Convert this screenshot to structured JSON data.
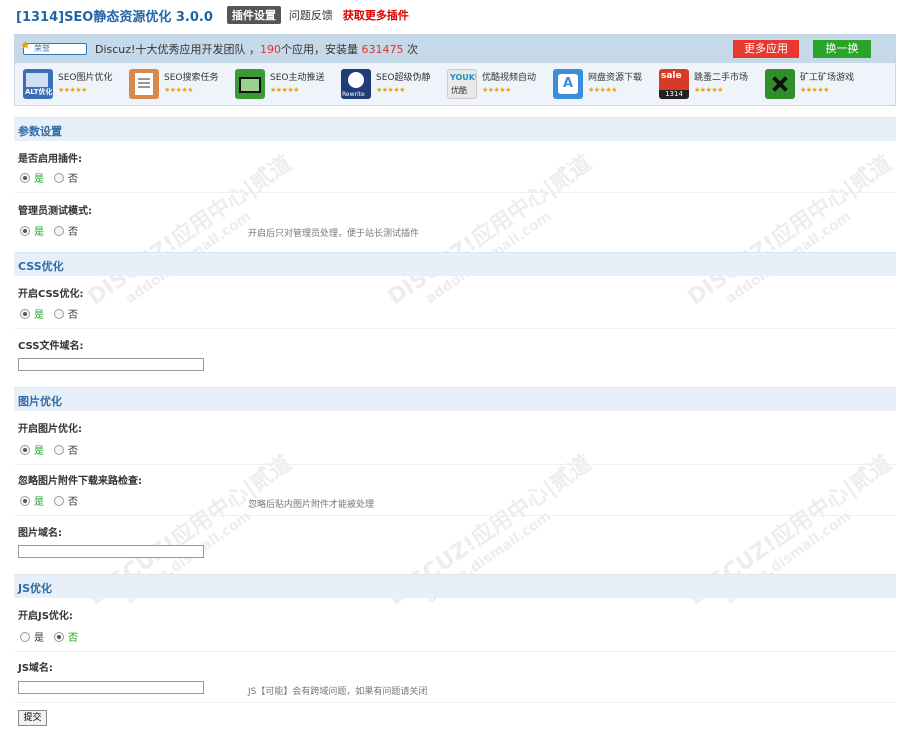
{
  "header": {
    "plugin_title": "[1314]SEO静态资源优化 3.0.0",
    "tab_settings": "插件设置",
    "tab_feedback": "问题反馈",
    "tab_more_plugins": "获取更多插件"
  },
  "banner": {
    "badge": "荣誉",
    "text_prefix": "Discuz!十大优秀应用开发团队 ，",
    "app_count": "190",
    "text_mid": "个应用，安装量 ",
    "install_count": "631475",
    "text_suffix": " 次",
    "more_apps": "更多应用",
    "swap": "换一换",
    "stars": "★★★★★",
    "apps": [
      {
        "name": "SEO图片优化",
        "icon": "image-seo-icon",
        "color": "#3a6fb7"
      },
      {
        "name": "SEO搜索任务",
        "icon": "clipboard-icon",
        "color": "#d8894b"
      },
      {
        "name": "SEO主动推送",
        "icon": "push-icon",
        "color": "#3a9b36"
      },
      {
        "name": "SEO超级伪静",
        "icon": "rewrite-icon",
        "color": "#1f3c77"
      },
      {
        "name": "优酷视频自动",
        "icon": "youku-icon",
        "color": "#e9e9e9"
      },
      {
        "name": "网盘资源下载",
        "icon": "appstore-icon",
        "color": "#3c8dd9"
      },
      {
        "name": "跳蚤二手市场",
        "icon": "sale-icon",
        "color": "#d93a27"
      },
      {
        "name": "矿工矿场游戏",
        "icon": "mining-icon",
        "color": "#2f8f2a"
      }
    ]
  },
  "sections": {
    "params": "参数设置",
    "css": "CSS优化",
    "image": "图片优化",
    "js": "JS优化"
  },
  "fields": {
    "enable_plugin": "是否启用插件:",
    "admin_test": "管理员测试模式:",
    "admin_test_hint": "开启后只对管理员处理，便于站长测试插件",
    "enable_css": "开启CSS优化:",
    "css_domain": "CSS文件域名:",
    "enable_image": "开启图片优化:",
    "ignore_image_check": "忽略图片附件下载来路检查:",
    "ignore_image_hint": "忽略后贴内图片附件才能被处理",
    "image_domain": "图片域名:",
    "enable_js": "开启JS优化:",
    "js_domain": "JS域名:",
    "js_domain_hint": "JS【可能】会有跨域问题，如果有问题请关闭"
  },
  "radio": {
    "yes": "是",
    "no": "否"
  },
  "inputs": {
    "css_domain": "",
    "image_domain": "",
    "js_domain": ""
  },
  "submit": "提交",
  "watermark": {
    "brand": "DISCUZ!应用中心|贰道",
    "domain": "addon.dismall.com"
  }
}
